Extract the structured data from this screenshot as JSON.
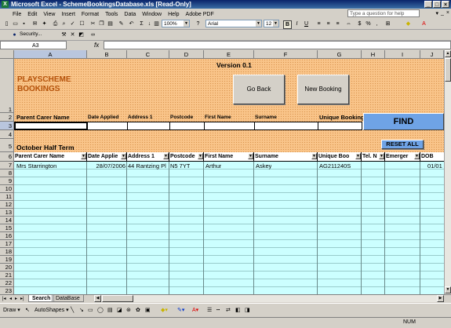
{
  "window": {
    "title": "Microsoft Excel - SchemeBookingsDatabase.xls  [Read-Only]",
    "controls": [
      "_",
      "□",
      "×"
    ]
  },
  "menu": {
    "items": [
      "File",
      "Edit",
      "View",
      "Insert",
      "Format",
      "Tools",
      "Data",
      "Window",
      "Help",
      "Adobe PDF"
    ],
    "help_placeholder": "Type a question for help",
    "doc_controls": [
      "▾",
      "_",
      "×"
    ]
  },
  "toolbar": {
    "zoom": "100%",
    "font": "Arial",
    "size": "12",
    "bold": "B",
    "italic": "I",
    "underline": "U",
    "security_label": "Security..."
  },
  "formula_bar": {
    "name_box": "A3",
    "fx": "fx",
    "content": ""
  },
  "columns": [
    "A",
    "B",
    "C",
    "D",
    "E",
    "F",
    "G",
    "H",
    "I",
    "J"
  ],
  "rows": [
    "1",
    "2",
    "3",
    "4",
    "5",
    "6",
    "7",
    "8",
    "9",
    "10",
    "11",
    "12",
    "13",
    "14",
    "15",
    "16",
    "17",
    "18",
    "19",
    "20",
    "21",
    "22",
    "23"
  ],
  "sheet": {
    "version": "Version 0.1",
    "title_line1": "PLAYSCHEME",
    "title_line2": "BOOKINGS",
    "go_back": "Go Back",
    "new_booking": "New Booking",
    "find": "FIND",
    "reset_all": "RESET ALL",
    "term": "October Half Term",
    "search_headers": [
      "Parent Carer Name",
      "Date Applied",
      "Address 1",
      "Postcode",
      "First Name",
      "Surname",
      "Unique Booking"
    ],
    "filter_headers": [
      "Parent Carer Name",
      "Date Applie",
      "Address 1",
      "Postcode",
      "First Name",
      "Surname",
      "Unique Boo",
      "Tel. N",
      "Emerger",
      "DOB"
    ],
    "record": {
      "parent": "Mrs Starrington",
      "date": "28/07/2006",
      "address": "44 Rantzing Pl",
      "postcode": "N5 7YT",
      "first": "Arthur",
      "surname": "Askey",
      "booking": "AG211240S",
      "dob": "01/01"
    }
  },
  "tabs": {
    "nav": [
      "|◂",
      "◂",
      "▸",
      "▸|"
    ],
    "sheets": [
      "Search",
      "DataBase"
    ]
  },
  "drawing": {
    "draw": "Draw ▾",
    "autoshapes": "AutoShapes ▾"
  },
  "status": {
    "num": "NUM"
  }
}
